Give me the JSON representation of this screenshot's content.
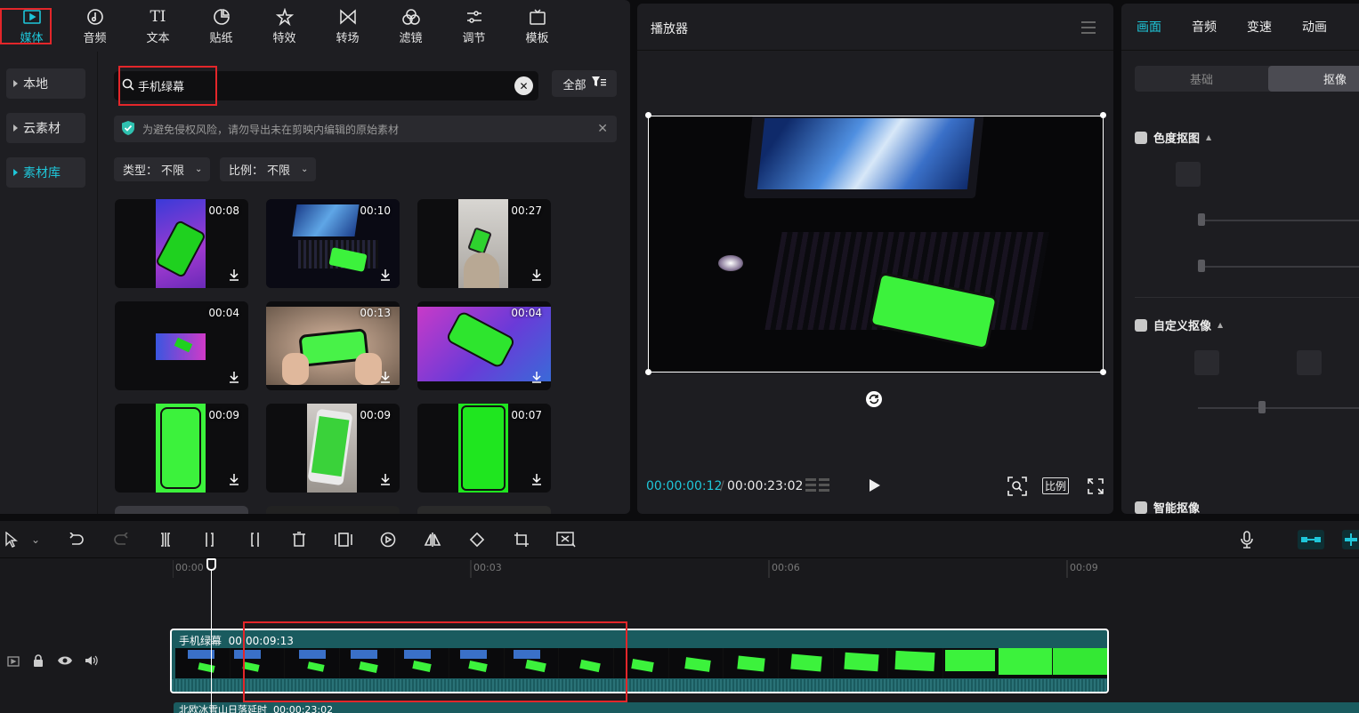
{
  "toolbar": {
    "items": [
      {
        "label": "媒体",
        "icon": "media-icon"
      },
      {
        "label": "音频",
        "icon": "music-note-icon"
      },
      {
        "label": "文本",
        "icon": "text-icon"
      },
      {
        "label": "贴纸",
        "icon": "sticker-icon"
      },
      {
        "label": "特效",
        "icon": "sparkle-star-icon"
      },
      {
        "label": "转场",
        "icon": "transition-bowtie-icon"
      },
      {
        "label": "滤镜",
        "icon": "filter-circles-icon"
      },
      {
        "label": "调节",
        "icon": "sliders-icon"
      },
      {
        "label": "模板",
        "icon": "template-icon"
      }
    ],
    "active_index": 0
  },
  "sidebar": {
    "items": [
      {
        "label": "本地"
      },
      {
        "label": "云素材"
      },
      {
        "label": "素材库"
      }
    ],
    "active_index": 2
  },
  "search": {
    "value": "手机绿幕",
    "placeholder": ""
  },
  "filter_button": {
    "label": "全部"
  },
  "notice": {
    "text": "为避免侵权风险，请勿导出未在剪映内编辑的原始素材"
  },
  "dropdowns": {
    "type": {
      "label": "类型：",
      "value": "不限"
    },
    "ratio": {
      "label": "比例：",
      "value": "不限"
    }
  },
  "media_grid": [
    {
      "duration": "00:08"
    },
    {
      "duration": "00:10"
    },
    {
      "duration": "00:27"
    },
    {
      "duration": "00:04"
    },
    {
      "duration": "00:13"
    },
    {
      "duration": "00:04"
    },
    {
      "duration": "00:09"
    },
    {
      "duration": "00:09"
    },
    {
      "duration": "00:07"
    }
  ],
  "player": {
    "title": "播放器",
    "current_time": "00:00:00:12",
    "total_time": "00:00:23:02",
    "ratio_label": "比例"
  },
  "inspector": {
    "tabs": [
      "画面",
      "音频",
      "变速",
      "动画"
    ],
    "active_tab": 0,
    "subtabs": [
      "基础",
      "抠像"
    ],
    "active_subtab": 1,
    "sections": {
      "chroma_key": "色度抠图",
      "custom_key": "自定义抠像",
      "smart_key": "智能抠像"
    }
  },
  "timeline": {
    "ruler_labels": [
      "00:00",
      "00:03",
      "00:06",
      "00:09"
    ],
    "video_clip": {
      "name": "手机绿幕",
      "duration": "00:00:09:13"
    },
    "audio_clip": {
      "name": "北欧冰雪山日落延时",
      "duration": "00:00:23:02"
    }
  },
  "colors": {
    "accent": "#1fc6d9",
    "highlight": "#e3262a",
    "green_screen": "#3cf23c"
  }
}
